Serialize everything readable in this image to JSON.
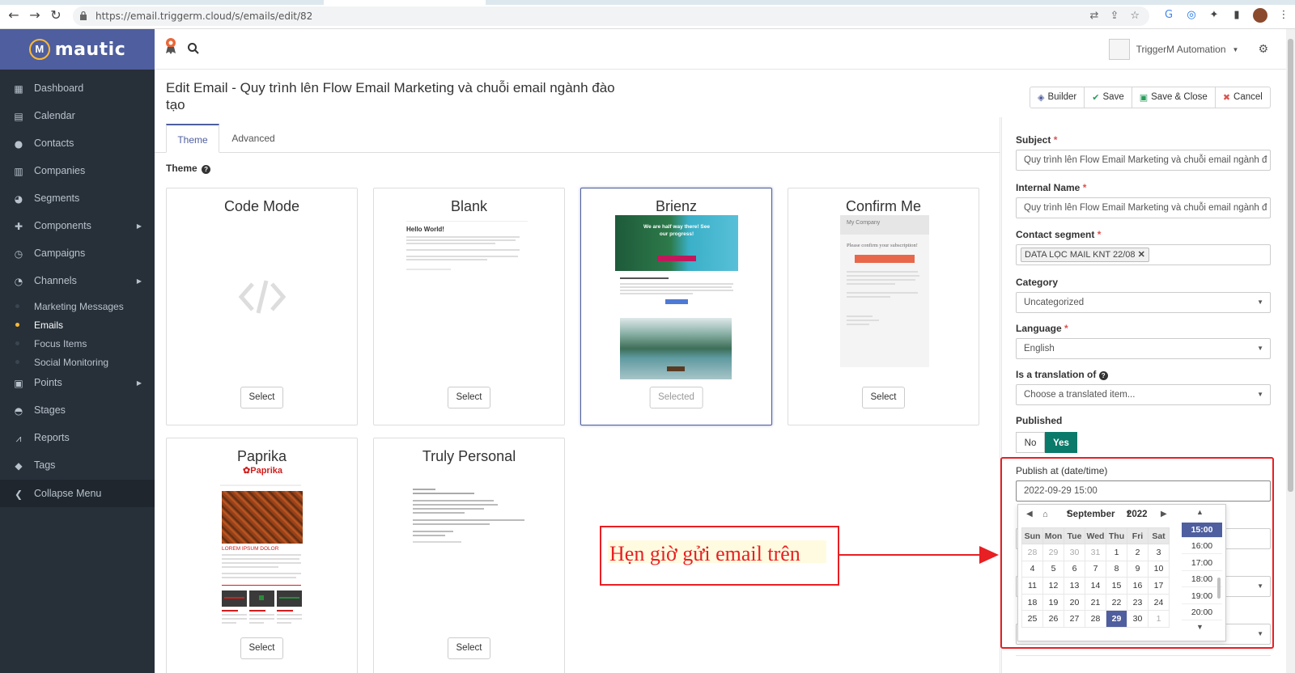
{
  "browser": {
    "url": "https://email.triggerm.cloud/s/emails/edit/82"
  },
  "sidebar": {
    "logo_text": "mautic",
    "items": [
      {
        "label": "Dashboard",
        "icon": "dashboard-icon"
      },
      {
        "label": "Calendar",
        "icon": "calendar-icon"
      },
      {
        "label": "Contacts",
        "icon": "user-icon"
      },
      {
        "label": "Companies",
        "icon": "building-icon"
      },
      {
        "label": "Segments",
        "icon": "pie-chart-icon"
      },
      {
        "label": "Components",
        "icon": "puzzle-icon"
      },
      {
        "label": "Campaigns",
        "icon": "clock-icon"
      },
      {
        "label": "Channels",
        "icon": "rss-icon"
      }
    ],
    "channel_subitems": [
      "Marketing Messages",
      "Emails",
      "Focus Items",
      "Social Monitoring"
    ],
    "items_after": [
      {
        "label": "Points",
        "icon": "calculator-icon"
      },
      {
        "label": "Stages",
        "icon": "tachometer-icon"
      },
      {
        "label": "Reports",
        "icon": "line-chart-icon"
      },
      {
        "label": "Tags",
        "icon": "tag-icon"
      },
      {
        "label": "Collapse Menu",
        "icon": "chevron-left-icon"
      }
    ]
  },
  "header": {
    "user_name": "TriggerM Automation"
  },
  "page": {
    "title": "Edit Email - Quy trình lên Flow Email Marketing và chuỗi email ngành đào tạo",
    "buttons": {
      "builder": "Builder",
      "save": "Save",
      "save_close": "Save & Close",
      "cancel": "Cancel"
    }
  },
  "tabs": [
    "Theme",
    "Advanced"
  ],
  "theme_label": "Theme",
  "themes": [
    {
      "name": "Code Mode",
      "button": "Select"
    },
    {
      "name": "Blank",
      "button": "Select"
    },
    {
      "name": "Brienz",
      "button": "Selected"
    },
    {
      "name": "Confirm Me",
      "button": "Select"
    },
    {
      "name": "Paprika",
      "button": "Select"
    },
    {
      "name": "Truly Personal",
      "button": "Select"
    }
  ],
  "previews": {
    "blank_heading": "Hello World!",
    "brienz_headline": "We are half way there! See our progress!",
    "confirm_company": "My Company",
    "confirm_text": "Please confirm your subscription!",
    "paprika_logo": "Paprika",
    "paprika_heading": "LOREM IPSUM DOLOR"
  },
  "form": {
    "subject_label": "Subject",
    "subject_value": "Quy trình lên Flow Email Marketing và chuỗi email ngành đ",
    "internal_name_label": "Internal Name",
    "internal_name_value": "Quy trình lên Flow Email Marketing và chuỗi email ngành đ",
    "segment_label": "Contact segment",
    "segment_tag": "DATA LỌC MAIL KNT 22/08",
    "category_label": "Category",
    "category_value": "Uncategorized",
    "language_label": "Language",
    "language_value": "English",
    "translation_label": "Is a translation of",
    "translation_placeholder": "Choose a translated item...",
    "published_label": "Published",
    "published_no": "No",
    "published_yes": "Yes",
    "publish_at_label": "Publish at (date/time)",
    "publish_at_value": "2022-09-29 15:00"
  },
  "callout_text": "Hẹn giờ gửi email trên",
  "datepicker": {
    "month": "September",
    "year": "2022",
    "weekdays": [
      "Sun",
      "Mon",
      "Tue",
      "Wed",
      "Thu",
      "Fri",
      "Sat"
    ],
    "weeks": [
      [
        "28",
        "29",
        "30",
        "31",
        "1",
        "2",
        "3"
      ],
      [
        "4",
        "5",
        "6",
        "7",
        "8",
        "9",
        "10"
      ],
      [
        "11",
        "12",
        "13",
        "14",
        "15",
        "16",
        "17"
      ],
      [
        "18",
        "19",
        "20",
        "21",
        "22",
        "23",
        "24"
      ],
      [
        "25",
        "26",
        "27",
        "28",
        "29",
        "30",
        "1"
      ]
    ],
    "selected_day": "29",
    "times": [
      "15:00",
      "16:00",
      "17:00",
      "18:00",
      "19:00",
      "20:00"
    ],
    "selected_time": "15:00"
  },
  "colors": {
    "sidebar_bg": "#273039",
    "brand": "#4e5e9e",
    "annotation_red": "#e81f23",
    "published_yes": "#0a7a6a"
  }
}
